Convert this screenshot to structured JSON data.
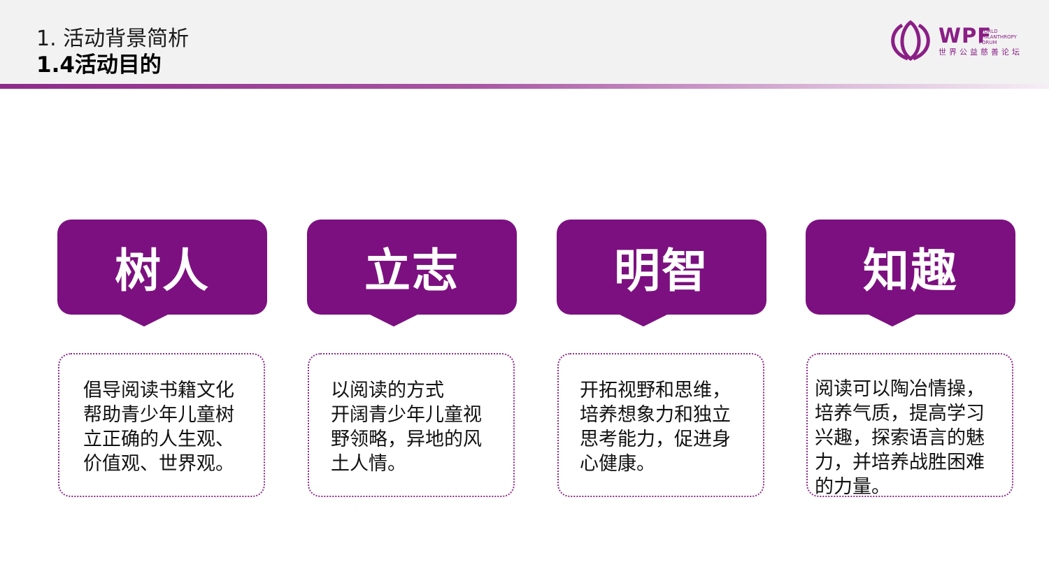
{
  "header": {
    "subtitle": "1. 活动背景简析",
    "title": "1.4活动目的"
  },
  "logo": {
    "acronym": "WPF",
    "english_lines": [
      "WORLD",
      "PHILANTHROPY",
      "FORUM"
    ],
    "chinese": "世界公益慈善论坛",
    "color": "#8a1f86"
  },
  "accent_color": "#7c1080",
  "goals": [
    {
      "label": "树人",
      "lines": [
        "倡导阅读书籍文化",
        "帮助青少年儿童树",
        "立正确的人生观、",
        "价值观、世界观。"
      ]
    },
    {
      "label": "立志",
      "lines": [
        "以阅读的方式",
        "开阔青少年儿童视",
        "野领略，异地的风",
        "土人情。"
      ]
    },
    {
      "label": "明智",
      "lines": [
        "开拓视野和思维，",
        "培养想象力和独立",
        "思考能力，促进身",
        "心健康。"
      ]
    },
    {
      "label": "知趣",
      "lines": [
        "阅读可以陶冶情操，",
        "培养气质，提高学习",
        "兴趣，探索语言的魅",
        "力，并培养战胜困难",
        "的力量。"
      ]
    }
  ]
}
